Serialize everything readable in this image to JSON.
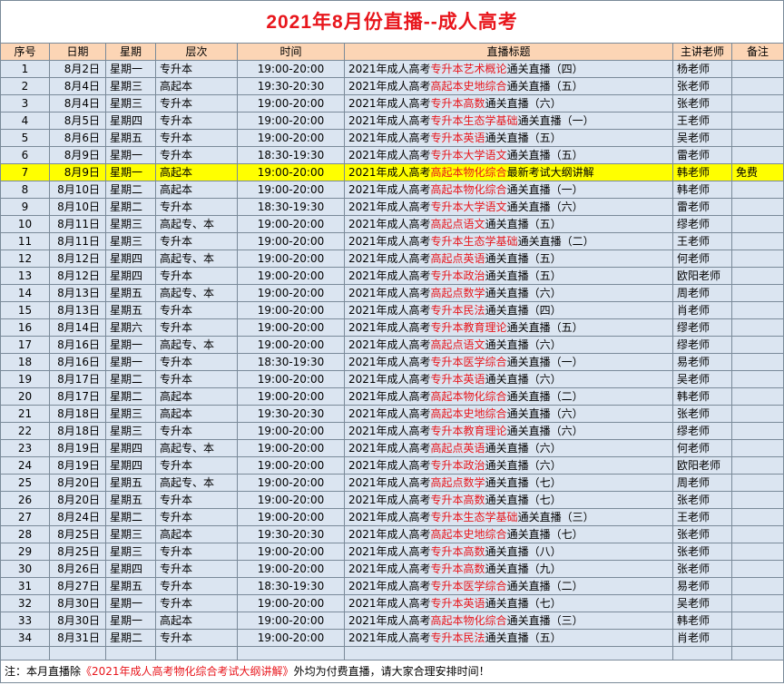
{
  "title": "2021年8月份直播--成人高考",
  "headers": [
    "序号",
    "日期",
    "星期",
    "层次",
    "时间",
    "直播标题",
    "主讲老师",
    "备注"
  ],
  "rows": [
    {
      "no": "1",
      "date": "8月2日",
      "weekday": "星期一",
      "level": "专升本",
      "time": "19:00-20:00",
      "t_pre": "2021年成人高考",
      "t_red": "专升本艺术概论",
      "t_post": "通关直播（四）",
      "teacher": "杨老师",
      "note": ""
    },
    {
      "no": "2",
      "date": "8月4日",
      "weekday": "星期三",
      "level": "高起本",
      "time": "19:30-20:30",
      "t_pre": "2021年成人高考",
      "t_red": "高起本史地综合",
      "t_post": "通关直播（五）",
      "teacher": "张老师",
      "note": ""
    },
    {
      "no": "3",
      "date": "8月4日",
      "weekday": "星期三",
      "level": "专升本",
      "time": "19:00-20:00",
      "t_pre": "2021年成人高考",
      "t_red": "专升本高数",
      "t_post": "通关直播（六）",
      "teacher": "张老师",
      "note": ""
    },
    {
      "no": "4",
      "date": "8月5日",
      "weekday": "星期四",
      "level": "专升本",
      "time": "19:00-20:00",
      "t_pre": "2021年成人高考",
      "t_red": "专升本生态学基础",
      "t_post": "通关直播（一）",
      "teacher": "王老师",
      "note": ""
    },
    {
      "no": "5",
      "date": "8月6日",
      "weekday": "星期五",
      "level": "专升本",
      "time": "19:00-20:00",
      "t_pre": "2021年成人高考",
      "t_red": "专升本英语",
      "t_post": "通关直播（五）",
      "teacher": "吴老师",
      "note": ""
    },
    {
      "no": "6",
      "date": "8月9日",
      "weekday": "星期一",
      "level": "专升本",
      "time": "18:30-19:30",
      "t_pre": "2021年成人高考",
      "t_red": "专升本大学语文",
      "t_post": "通关直播（五）",
      "teacher": "雷老师",
      "note": ""
    },
    {
      "no": "7",
      "date": "8月9日",
      "weekday": "星期一",
      "level": "高起本",
      "time": "19:00-20:00",
      "t_pre": "2021年成人高考",
      "t_red": "高起本物化综合",
      "t_post": "最新考试大纲讲解",
      "teacher": "韩老师",
      "note": "免费",
      "hl": true
    },
    {
      "no": "8",
      "date": "8月10日",
      "weekday": "星期二",
      "level": "高起本",
      "time": "19:00-20:00",
      "t_pre": "2021年成人高考",
      "t_red": "高起本物化综合",
      "t_post": "通关直播（一）",
      "teacher": "韩老师",
      "note": ""
    },
    {
      "no": "9",
      "date": "8月10日",
      "weekday": "星期二",
      "level": "专升本",
      "time": "18:30-19:30",
      "t_pre": "2021年成人高考",
      "t_red": "专升本大学语文",
      "t_post": "通关直播（六）",
      "teacher": "雷老师",
      "note": ""
    },
    {
      "no": "10",
      "date": "8月11日",
      "weekday": "星期三",
      "level": "高起专、本",
      "time": "19:00-20:00",
      "t_pre": "2021年成人高考",
      "t_red": "高起点语文",
      "t_post": "通关直播（五）",
      "teacher": "缪老师",
      "note": ""
    },
    {
      "no": "11",
      "date": "8月11日",
      "weekday": "星期三",
      "level": "专升本",
      "time": "19:00-20:00",
      "t_pre": "2021年成人高考",
      "t_red": "专升本生态学基础",
      "t_post": "通关直播（二）",
      "teacher": "王老师",
      "note": ""
    },
    {
      "no": "12",
      "date": "8月12日",
      "weekday": "星期四",
      "level": "高起专、本",
      "time": "19:00-20:00",
      "t_pre": "2021年成人高考",
      "t_red": "高起点英语",
      "t_post": "通关直播（五）",
      "teacher": "何老师",
      "note": ""
    },
    {
      "no": "13",
      "date": "8月12日",
      "weekday": "星期四",
      "level": "专升本",
      "time": "19:00-20:00",
      "t_pre": "2021年成人高考",
      "t_red": "专升本政治",
      "t_post": "通关直播（五）",
      "teacher": "欧阳老师",
      "note": ""
    },
    {
      "no": "14",
      "date": "8月13日",
      "weekday": "星期五",
      "level": "高起专、本",
      "time": "19:00-20:00",
      "t_pre": "2021年成人高考",
      "t_red": "高起点数学",
      "t_post": "通关直播（六）",
      "teacher": "周老师",
      "note": ""
    },
    {
      "no": "15",
      "date": "8月13日",
      "weekday": "星期五",
      "level": "专升本",
      "time": "19:00-20:00",
      "t_pre": "2021年成人高考",
      "t_red": "专升本民法",
      "t_post": "通关直播（四）",
      "teacher": "肖老师",
      "note": ""
    },
    {
      "no": "16",
      "date": "8月14日",
      "weekday": "星期六",
      "level": "专升本",
      "time": "19:00-20:00",
      "t_pre": "2021年成人高考",
      "t_red": "专升本教育理论",
      "t_post": "通关直播（五）",
      "teacher": "缪老师",
      "note": ""
    },
    {
      "no": "17",
      "date": "8月16日",
      "weekday": "星期一",
      "level": "高起专、本",
      "time": "19:00-20:00",
      "t_pre": "2021年成人高考",
      "t_red": "高起点语文",
      "t_post": "通关直播（六）",
      "teacher": "缪老师",
      "note": ""
    },
    {
      "no": "18",
      "date": "8月16日",
      "weekday": "星期一",
      "level": "专升本",
      "time": "18:30-19:30",
      "t_pre": "2021年成人高考",
      "t_red": "专升本医学综合",
      "t_post": "通关直播（一）",
      "teacher": "易老师",
      "note": ""
    },
    {
      "no": "19",
      "date": "8月17日",
      "weekday": "星期二",
      "level": "专升本",
      "time": "19:00-20:00",
      "t_pre": "2021年成人高考",
      "t_red": "专升本英语",
      "t_post": "通关直播（六）",
      "teacher": "吴老师",
      "note": ""
    },
    {
      "no": "20",
      "date": "8月17日",
      "weekday": "星期二",
      "level": "高起本",
      "time": "19:00-20:00",
      "t_pre": "2021年成人高考",
      "t_red": "高起本物化综合",
      "t_post": "通关直播（二）",
      "teacher": "韩老师",
      "note": ""
    },
    {
      "no": "21",
      "date": "8月18日",
      "weekday": "星期三",
      "level": "高起本",
      "time": "19:30-20:30",
      "t_pre": "2021年成人高考",
      "t_red": "高起本史地综合",
      "t_post": "通关直播（六）",
      "teacher": "张老师",
      "note": ""
    },
    {
      "no": "22",
      "date": "8月18日",
      "weekday": "星期三",
      "level": "专升本",
      "time": "19:00-20:00",
      "t_pre": "2021年成人高考",
      "t_red": "专升本教育理论",
      "t_post": "通关直播（六）",
      "teacher": "缪老师",
      "note": ""
    },
    {
      "no": "23",
      "date": "8月19日",
      "weekday": "星期四",
      "level": "高起专、本",
      "time": "19:00-20:00",
      "t_pre": "2021年成人高考",
      "t_red": "高起点英语",
      "t_post": "通关直播（六）",
      "teacher": "何老师",
      "note": ""
    },
    {
      "no": "24",
      "date": "8月19日",
      "weekday": "星期四",
      "level": "专升本",
      "time": "19:00-20:00",
      "t_pre": "2021年成人高考",
      "t_red": "专升本政治",
      "t_post": "通关直播（六）",
      "teacher": "欧阳老师",
      "note": ""
    },
    {
      "no": "25",
      "date": "8月20日",
      "weekday": "星期五",
      "level": "高起专、本",
      "time": "19:00-20:00",
      "t_pre": "2021年成人高考",
      "t_red": "高起点数学",
      "t_post": "通关直播（七）",
      "teacher": "周老师",
      "note": ""
    },
    {
      "no": "26",
      "date": "8月20日",
      "weekday": "星期五",
      "level": "专升本",
      "time": "19:00-20:00",
      "t_pre": "2021年成人高考",
      "t_red": "专升本高数",
      "t_post": "通关直播（七）",
      "teacher": "张老师",
      "note": ""
    },
    {
      "no": "27",
      "date": "8月24日",
      "weekday": "星期二",
      "level": "专升本",
      "time": "19:00-20:00",
      "t_pre": "2021年成人高考",
      "t_red": "专升本生态学基础",
      "t_post": "通关直播（三）",
      "teacher": "王老师",
      "note": ""
    },
    {
      "no": "28",
      "date": "8月25日",
      "weekday": "星期三",
      "level": "高起本",
      "time": "19:30-20:30",
      "t_pre": "2021年成人高考",
      "t_red": "高起本史地综合",
      "t_post": "通关直播（七）",
      "teacher": "张老师",
      "note": ""
    },
    {
      "no": "29",
      "date": "8月25日",
      "weekday": "星期三",
      "level": "专升本",
      "time": "19:00-20:00",
      "t_pre": "2021年成人高考",
      "t_red": "专升本高数",
      "t_post": "通关直播（八）",
      "teacher": "张老师",
      "note": ""
    },
    {
      "no": "30",
      "date": "8月26日",
      "weekday": "星期四",
      "level": "专升本",
      "time": "19:00-20:00",
      "t_pre": "2021年成人高考",
      "t_red": "专升本高数",
      "t_post": "通关直播（九）",
      "teacher": "张老师",
      "note": ""
    },
    {
      "no": "31",
      "date": "8月27日",
      "weekday": "星期五",
      "level": "专升本",
      "time": "18:30-19:30",
      "t_pre": "2021年成人高考",
      "t_red": "专升本医学综合",
      "t_post": "通关直播（二）",
      "teacher": "易老师",
      "note": ""
    },
    {
      "no": "32",
      "date": "8月30日",
      "weekday": "星期一",
      "level": "专升本",
      "time": "19:00-20:00",
      "t_pre": "2021年成人高考",
      "t_red": "专升本英语",
      "t_post": "通关直播（七）",
      "teacher": "吴老师",
      "note": ""
    },
    {
      "no": "33",
      "date": "8月30日",
      "weekday": "星期一",
      "level": "高起本",
      "time": "19:00-20:00",
      "t_pre": "2021年成人高考",
      "t_red": "高起本物化综合",
      "t_post": "通关直播（三）",
      "teacher": "韩老师",
      "note": ""
    },
    {
      "no": "34",
      "date": "8月31日",
      "weekday": "星期二",
      "level": "专升本",
      "time": "19:00-20:00",
      "t_pre": "2021年成人高考",
      "t_red": "专升本民法",
      "t_post": "通关直播（五）",
      "teacher": "肖老师",
      "note": ""
    }
  ],
  "footnote": {
    "pre": "注：本月直播除",
    "red": "《2021年成人高考物化综合考试大纲讲解》",
    "post": "外均为付费直播，请大家合理安排时间！"
  },
  "colors": {
    "title": "#e8161c",
    "header_bg": "#fcd5b5",
    "row_bg": "#dbe5f1",
    "highlight_bg": "#ffff00",
    "accent_red": "#e8161c"
  }
}
